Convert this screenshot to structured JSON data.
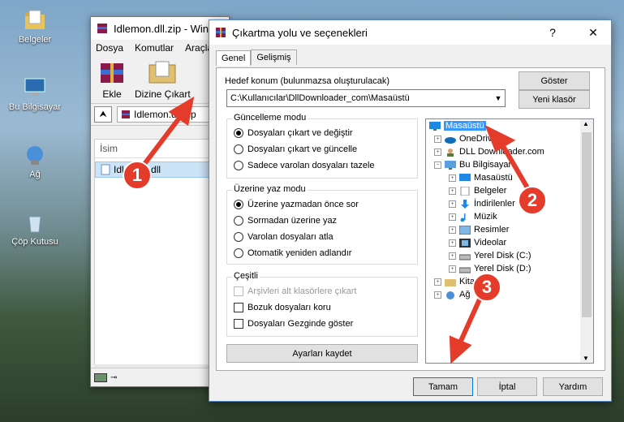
{
  "desktop": {
    "icons": [
      {
        "label": "Belgeler"
      },
      {
        "label": "Bu Bilgisayar"
      },
      {
        "label": "Ağ"
      },
      {
        "label": "Çöp Kutusu"
      }
    ]
  },
  "winrar": {
    "title": "Idlemon.dll.zip - Win",
    "menu": [
      "Dosya",
      "Komutlar",
      "Araçla"
    ],
    "tools": [
      {
        "label": "Ekle"
      },
      {
        "label": "Dizine Çıkart"
      }
    ],
    "path": "Idlemon.dll.zip",
    "column_name": "İsim",
    "file": "Idlemon.dll"
  },
  "dialog": {
    "title": "Çıkartma yolu ve seçenekleri",
    "help_btn": "?",
    "close_btn": "✕",
    "tabs": [
      "Genel",
      "Gelişmiş"
    ],
    "dest_label": "Hedef konum (bulunmazsa oluşturulacak)",
    "dest_value": "C:\\Kullanıcılar\\DllDownloader_com\\Masaüstü",
    "show_btn": "Göster",
    "new_folder_btn": "Yeni klasör",
    "update_mode": {
      "title": "Güncelleme modu",
      "options": [
        {
          "label": "Dosyaları çıkart ve değiştir",
          "selected": true
        },
        {
          "label": "Dosyaları çıkart ve güncelle",
          "selected": false
        },
        {
          "label": "Sadece varolan dosyaları tazele",
          "selected": false
        }
      ]
    },
    "overwrite_mode": {
      "title": "Üzerine yaz modu",
      "options": [
        {
          "label": "Üzerine yazmadan önce sor",
          "selected": true
        },
        {
          "label": "Sormadan üzerine yaz",
          "selected": false
        },
        {
          "label": "Varolan dosyaları atla",
          "selected": false
        },
        {
          "label": "Otomatik yeniden adlandır",
          "selected": false
        }
      ]
    },
    "misc": {
      "title": "Çeşitli",
      "options": [
        {
          "label": "Arşivleri alt klasörlere çıkart",
          "checked": false,
          "disabled": true
        },
        {
          "label": "Bozuk dosyaları koru",
          "checked": false,
          "disabled": false
        },
        {
          "label": "Dosyaları Gezginde göster",
          "checked": false,
          "disabled": false
        }
      ]
    },
    "save_settings_btn": "Ayarları kaydet",
    "tree": [
      {
        "label": "Masaüstü",
        "level": 0,
        "selected": true,
        "icon": "desktop-icon"
      },
      {
        "label": "OneDrive",
        "level": 1,
        "icon": "cloud-icon"
      },
      {
        "label": "DLL Downloader.com",
        "level": 1,
        "icon": "user-icon"
      },
      {
        "label": "Bu Bilgisayar",
        "level": 1,
        "icon": "computer-icon"
      },
      {
        "label": "Masaüstü",
        "level": 2,
        "icon": "desktop-icon"
      },
      {
        "label": "Belgeler",
        "level": 2,
        "icon": "documents-icon"
      },
      {
        "label": "İndirilenler",
        "level": 2,
        "icon": "download-icon"
      },
      {
        "label": "Müzik",
        "level": 2,
        "icon": "music-icon"
      },
      {
        "label": "Resimler",
        "level": 2,
        "icon": "pictures-icon"
      },
      {
        "label": "Videolar",
        "level": 2,
        "icon": "videos-icon"
      },
      {
        "label": "Yerel Disk (C:)",
        "level": 2,
        "icon": "drive-icon"
      },
      {
        "label": "Yerel Disk (D:)",
        "level": 2,
        "icon": "drive-icon"
      },
      {
        "label": "Kitaplıklar",
        "level": 1,
        "icon": "library-icon"
      },
      {
        "label": "Ağ",
        "level": 1,
        "icon": "network-icon"
      }
    ],
    "ok_btn": "Tamam",
    "cancel_btn": "İptal",
    "help_footer_btn": "Yardım"
  },
  "annotations": {
    "badges": [
      "1",
      "2",
      "3"
    ],
    "color": "#e53b2a"
  }
}
